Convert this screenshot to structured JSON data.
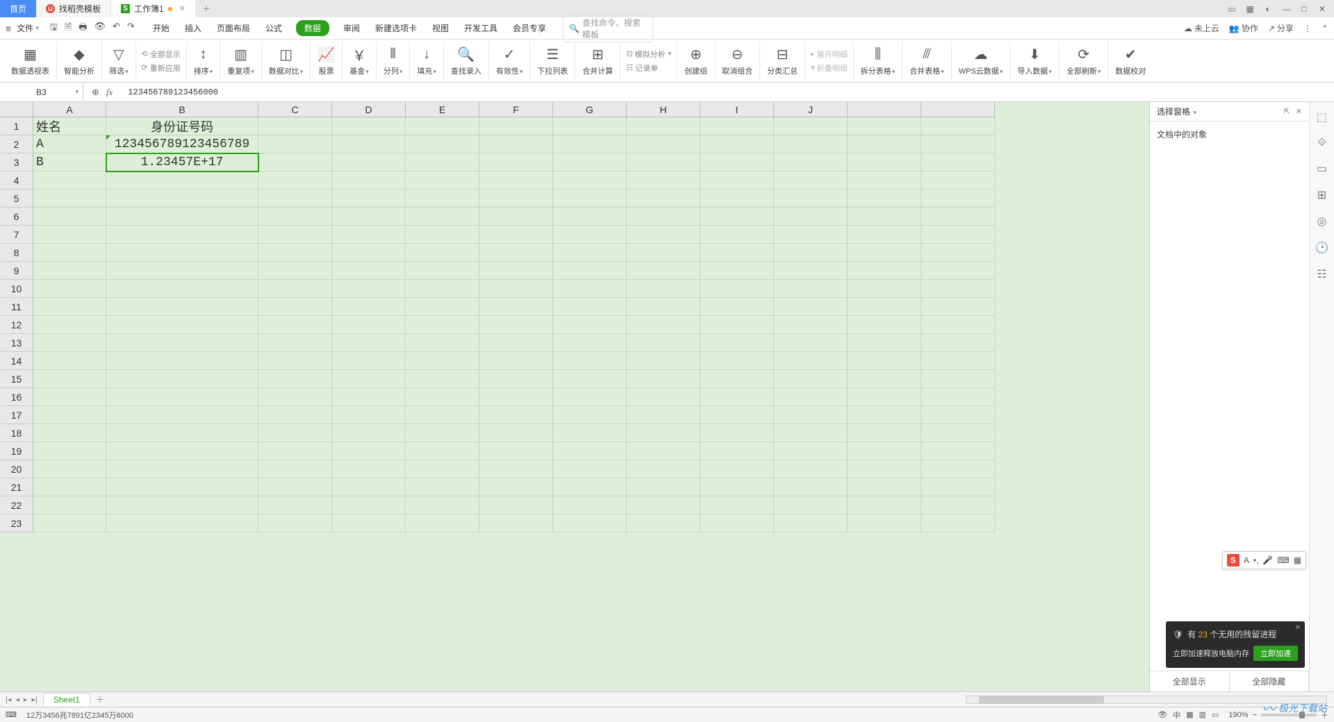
{
  "tabs": {
    "home": "首页",
    "template": "找稻壳模板",
    "workbook": "工作簿1"
  },
  "menu": {
    "file": "文件",
    "items": [
      "开始",
      "插入",
      "页面布局",
      "公式",
      "数据",
      "审阅",
      "新建选项卡",
      "视图",
      "开发工具",
      "会员专享"
    ],
    "active_index": 4,
    "search_placeholder": "查找命令、搜索模板"
  },
  "menu_right": {
    "cloud": "未上云",
    "collab": "协作",
    "share": "分享"
  },
  "ribbon": {
    "groups": [
      {
        "label": "数据透视表"
      },
      {
        "label": "智能分析"
      },
      {
        "label": "筛选"
      },
      {
        "label": "排序"
      },
      {
        "label": "重复项"
      },
      {
        "label": "数据对比"
      },
      {
        "label": "股票"
      },
      {
        "label": "基金"
      },
      {
        "label": "分列"
      },
      {
        "label": "填充"
      },
      {
        "label": "查找录入"
      },
      {
        "label": "有效性"
      },
      {
        "label": "下拉列表"
      },
      {
        "label": "合并计算"
      },
      {
        "label": "记录单"
      },
      {
        "label": "创建组"
      },
      {
        "label": "取消组合"
      },
      {
        "label": "分类汇总"
      },
      {
        "label": "拆分表格"
      },
      {
        "label": "合并表格"
      },
      {
        "label": "WPS云数据"
      },
      {
        "label": "导入数据"
      },
      {
        "label": "全部刷新"
      },
      {
        "label": "数据校对"
      }
    ],
    "mini": {
      "show_all": "全部显示",
      "reapply": "重新应用",
      "sim_analysis": "模拟分析",
      "expand": "展开明细",
      "collapse": "折叠明细"
    }
  },
  "formula_bar": {
    "cell_ref": "B3",
    "formula": "123456789123456000"
  },
  "columns": [
    "A",
    "B",
    "C",
    "D",
    "E",
    "F",
    "G",
    "H",
    "I",
    "J"
  ],
  "rows_count": 23,
  "cells": {
    "A1": "姓名",
    "B1": "身份证号码",
    "A2": "A",
    "B2": "123456789123456789",
    "A3": "B",
    "B3": "1.23457E+17"
  },
  "selected_cell": "B3",
  "right_panel": {
    "title": "选择窗格",
    "subtitle": "文档中的对象",
    "show_all": "全部显示",
    "hide_all": "全部隐藏"
  },
  "notification": {
    "prefix": "有",
    "count": "23",
    "suffix": "个无用的残留进程",
    "desc": "立即加速释放电脑内存",
    "action": "立即加速"
  },
  "sheet": {
    "name": "Sheet1"
  },
  "status": {
    "text": "12万3456兆7891亿2345万6000",
    "zoom": "190%"
  },
  "watermark": "极光下载站"
}
